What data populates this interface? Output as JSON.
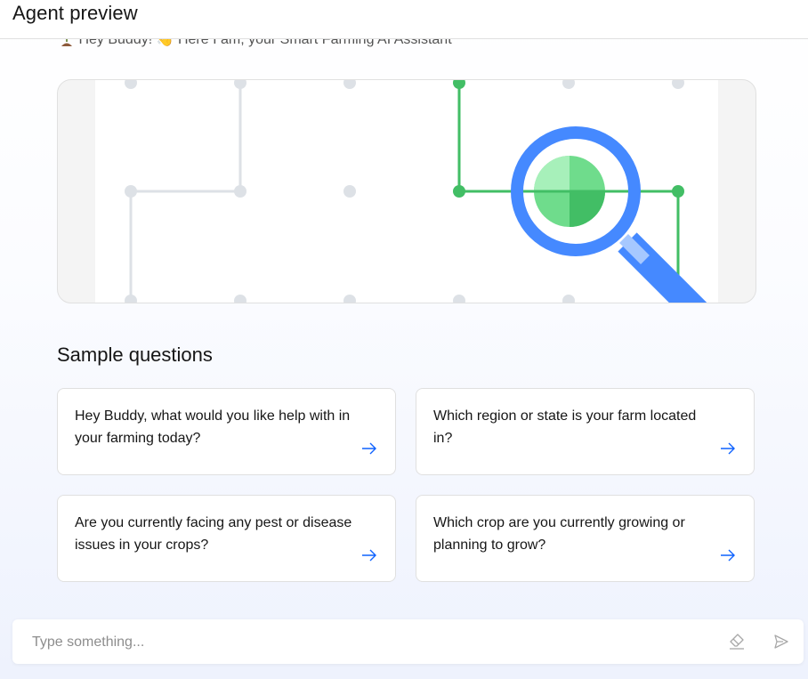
{
  "header": {
    "title": "Agent preview"
  },
  "greeting": {
    "text": "Hey Buddy! 👋 Here I am, your Smart Farming AI Assistant"
  },
  "sample_questions": {
    "title": "Sample questions",
    "items": [
      {
        "text": "Hey Buddy, what would you like help with in your farming today?"
      },
      {
        "text": "Which region or state is your farm located in?"
      },
      {
        "text": "Are you currently facing any pest or disease issues in your crops?"
      },
      {
        "text": "Which crop are you currently growing or planning to grow?"
      }
    ]
  },
  "composer": {
    "placeholder": "Type something..."
  },
  "icons": {
    "greeting": "seedling-icon",
    "card_arrow": "arrow-right-icon",
    "clear": "eraser-icon",
    "send": "send-icon"
  },
  "colors": {
    "accent_blue": "#0f62fe",
    "magnifier_blue": "#4589ff",
    "green": "#42be65",
    "light_green": "#6fdc8c",
    "pale_green": "#a7f0ba",
    "grid_gray": "#dde1e6"
  }
}
